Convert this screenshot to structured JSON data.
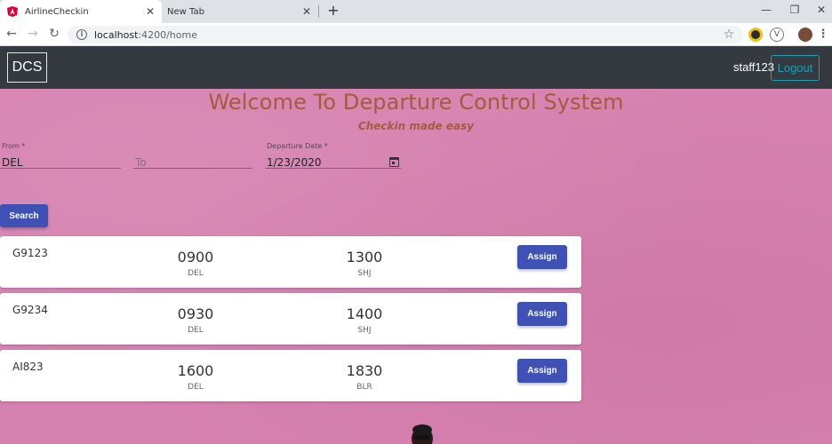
{
  "browser": {
    "tabs": [
      {
        "title": "AirlineCheckin",
        "active": true
      },
      {
        "title": "New Tab",
        "active": false
      }
    ],
    "url_host": "localhost",
    "url_path": ":4200/home",
    "colors": {
      "tab_icon": "#dd0031"
    }
  },
  "navbar": {
    "brand": "DCS",
    "username": "staff123",
    "logout_label": "Logout"
  },
  "header": {
    "title": "Welcome To Departure Control System",
    "subtitle": "Checkin made easy"
  },
  "form": {
    "from": {
      "label": "From *",
      "value": "DEL"
    },
    "to": {
      "placeholder": "To"
    },
    "date": {
      "label": "Departure Date *",
      "value": "1/23/2020"
    },
    "search_label": "Search"
  },
  "flights": [
    {
      "flight": "G9123",
      "dep_time": "0900",
      "dep_code": "DEL",
      "arr_time": "1300",
      "arr_code": "SHJ",
      "action": "Assign"
    },
    {
      "flight": "G9234",
      "dep_time": "0930",
      "dep_code": "DEL",
      "arr_time": "1400",
      "arr_code": "SHJ",
      "action": "Assign"
    },
    {
      "flight": "AI823",
      "dep_time": "1600",
      "dep_code": "DEL",
      "arr_time": "1830",
      "arr_code": "BLR",
      "action": "Assign"
    }
  ],
  "theme": {
    "background": "#d682b0",
    "navbar": "#343a40",
    "primary": "#3f51b5",
    "logout": "#17a2b8",
    "heading": "#a65a3c"
  }
}
